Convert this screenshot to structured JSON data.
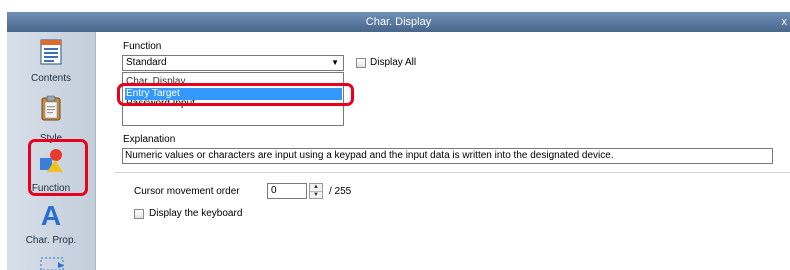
{
  "window": {
    "title": "Char. Display",
    "close_label": "x"
  },
  "sidebar": {
    "items": [
      {
        "label": "Contents",
        "icon": "contents-icon"
      },
      {
        "label": "Style",
        "icon": "clipboard-icon"
      },
      {
        "label": "Function",
        "icon": "shapes-icon"
      },
      {
        "label": "Char. Prop.",
        "icon": "letter-a-icon"
      }
    ]
  },
  "function": {
    "label": "Function",
    "selected": "Standard",
    "display_all_label": "Display All",
    "list_items": [
      "Char. Display",
      "Entry Target",
      "Password Input"
    ],
    "selected_index": 1
  },
  "explanation": {
    "label": "Explanation",
    "text": "Numeric values or characters are input using a keypad and the input data is written into the designated device."
  },
  "cursor": {
    "label": "Cursor movement order",
    "value": "0",
    "max_label": "/ 255"
  },
  "keyboard": {
    "label": "Display the keyboard"
  },
  "colors": {
    "highlight_box": "#e8001c",
    "selection": "#3399ff",
    "titlebar": "#48668c"
  }
}
